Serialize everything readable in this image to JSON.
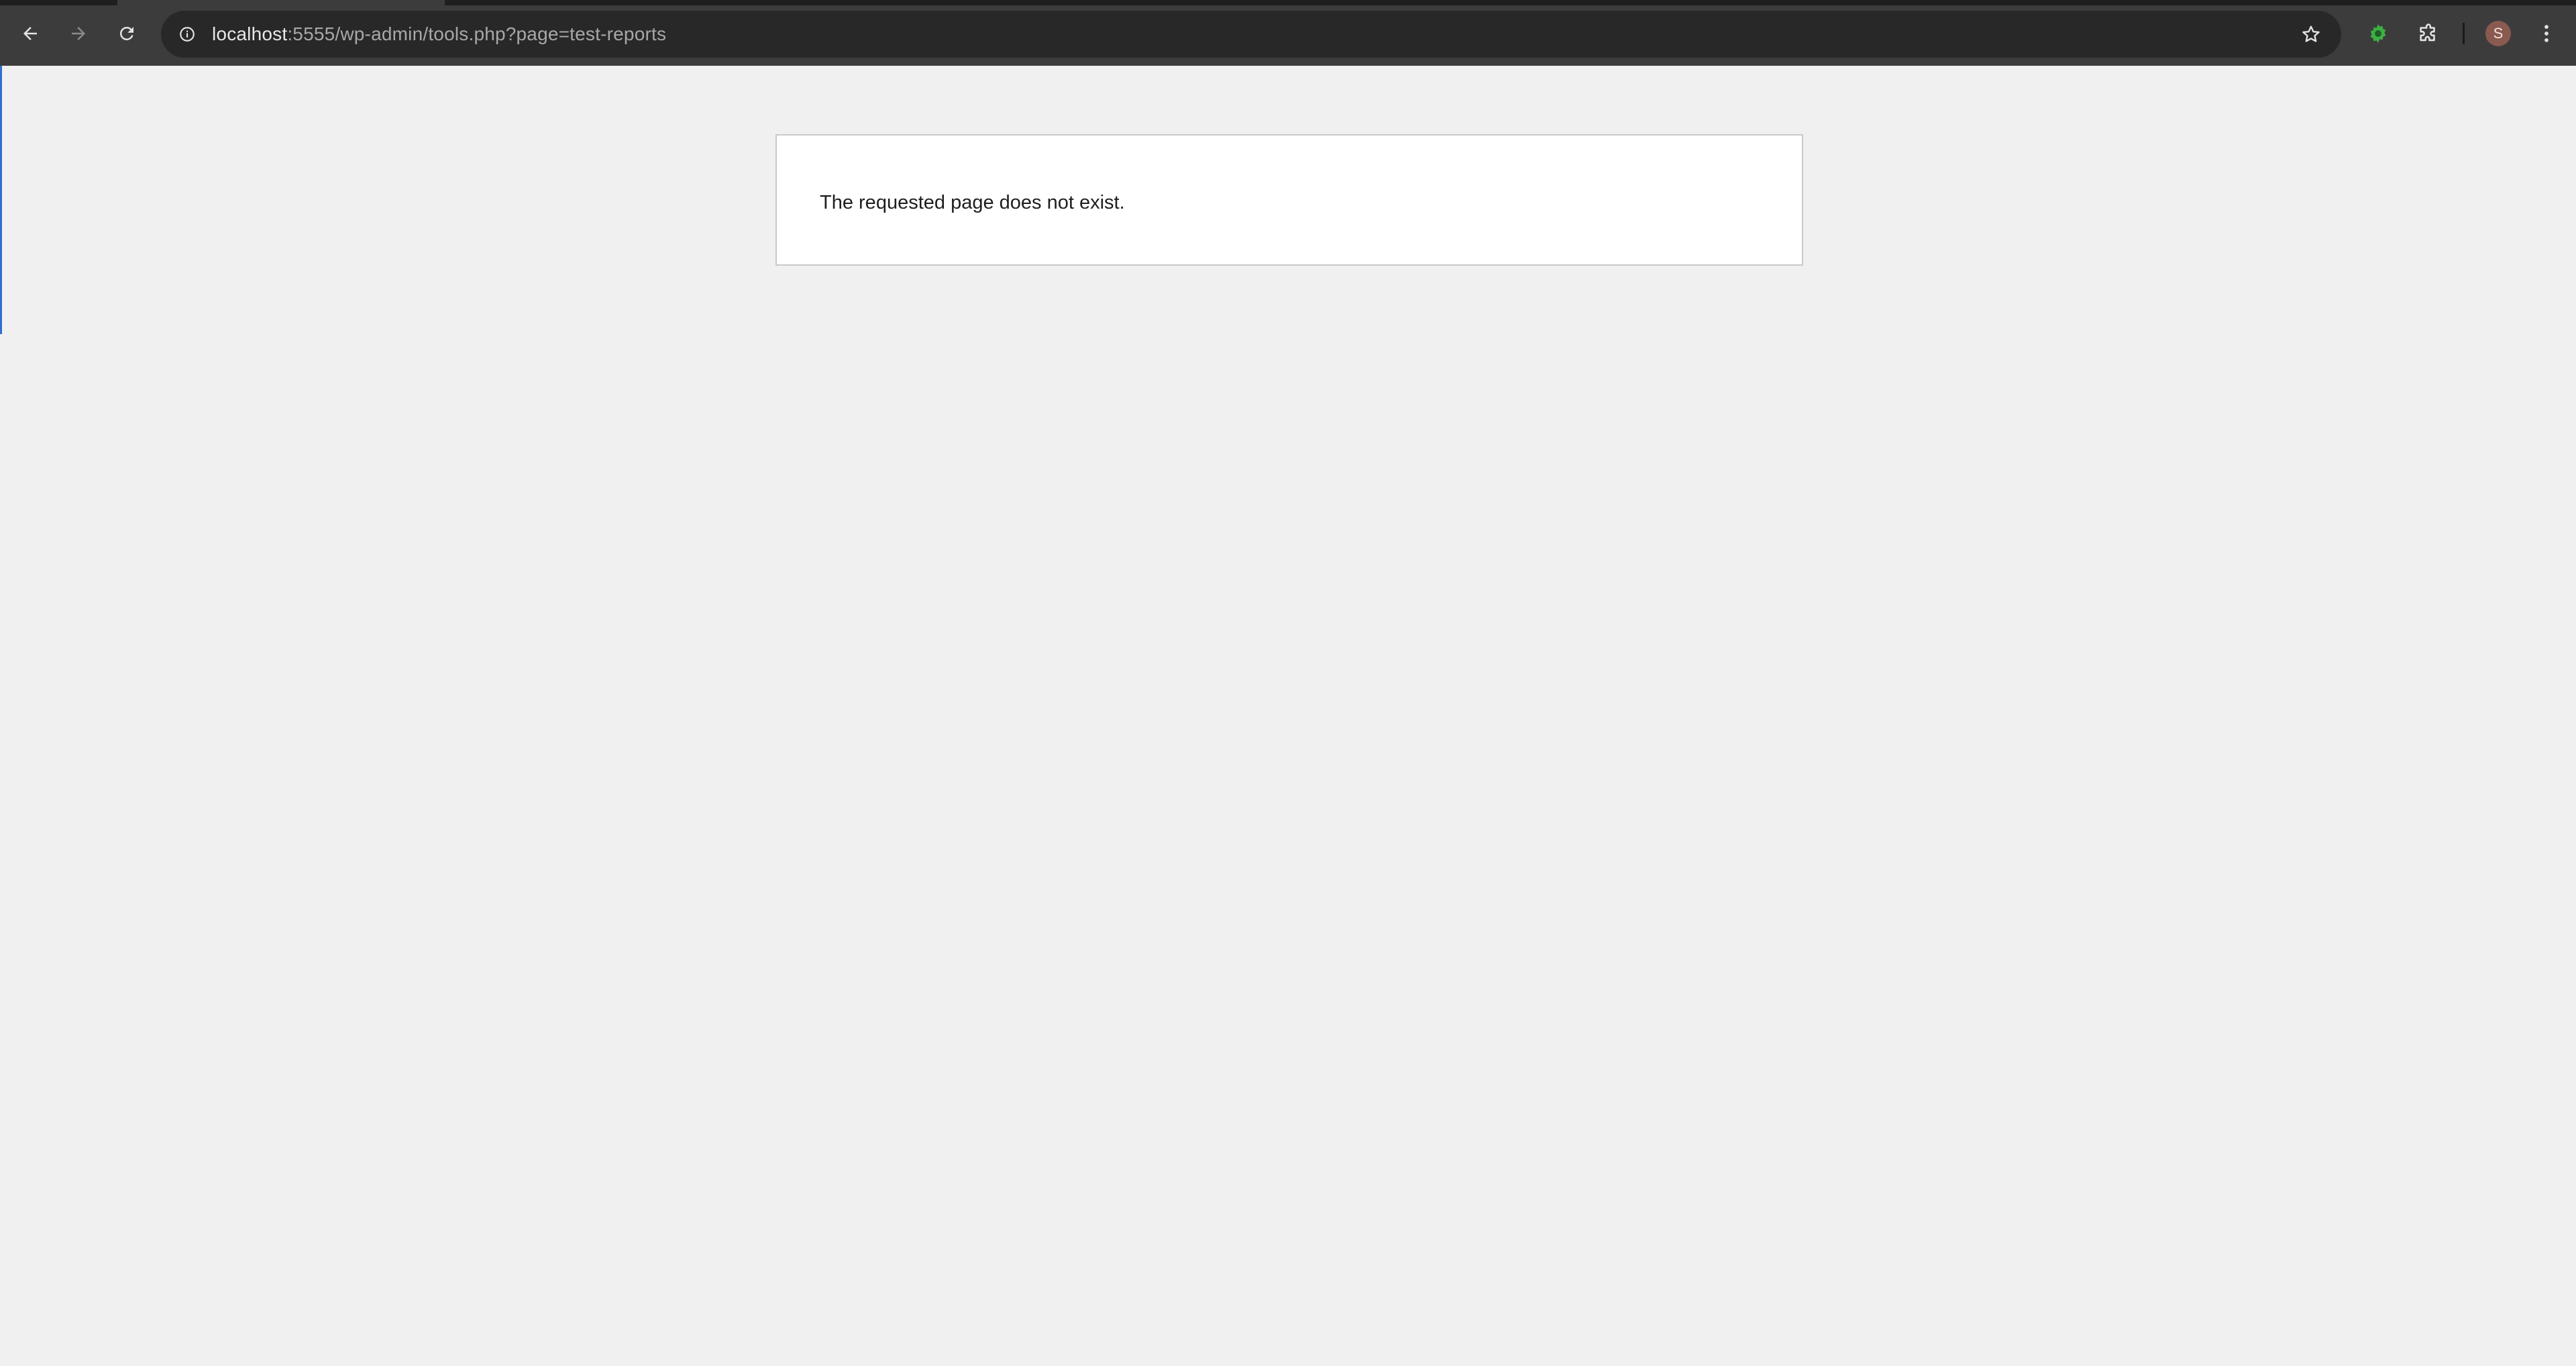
{
  "browser": {
    "url_host": "localhost",
    "url_rest": ":5555/wp-admin/tools.php?page=test-reports",
    "avatar_letter": "S",
    "accent_color": "#2f6fd1",
    "extension_color": "#3cb043"
  },
  "icons": {
    "back": "arrow-left-icon",
    "forward": "arrow-right-icon",
    "reload": "reload-icon",
    "site_info": "info-icon",
    "bookmark": "star-icon",
    "extension_active": "gear-icon",
    "extensions": "puzzle-piece-icon",
    "menu": "three-dots-vertical-icon"
  },
  "page": {
    "error_message": "The requested page does not exist."
  }
}
